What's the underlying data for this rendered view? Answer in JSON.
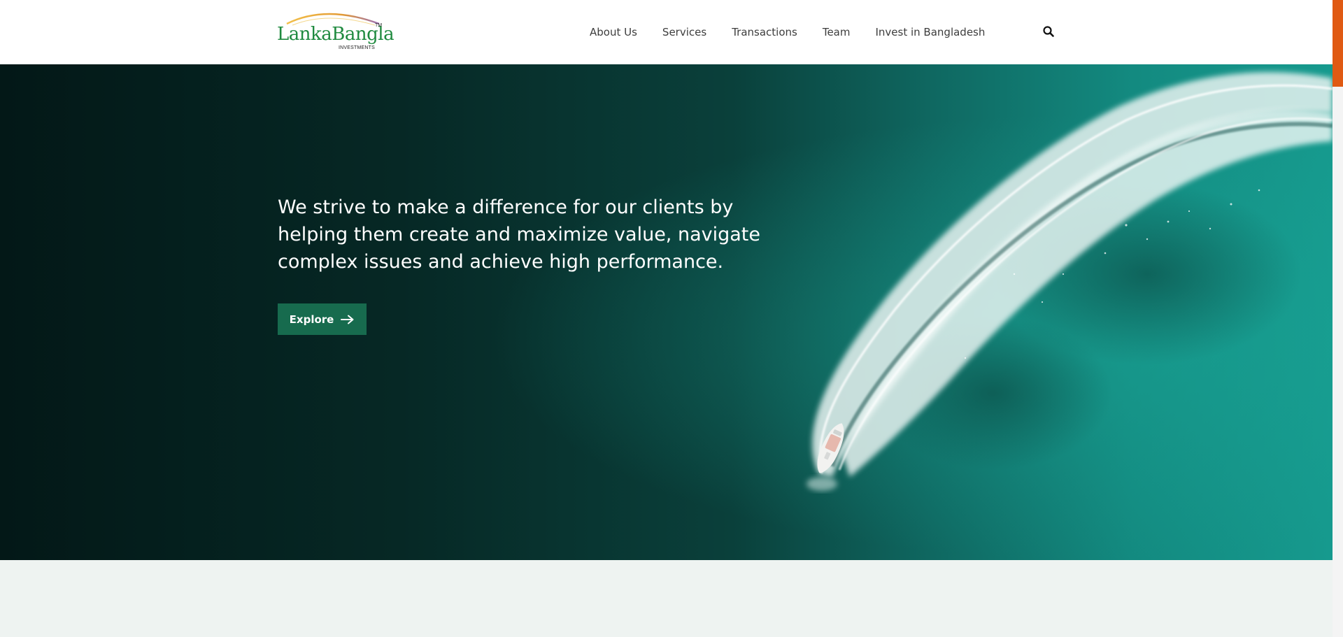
{
  "header": {
    "logo": {
      "word": "LankaBangla",
      "tm": "TM",
      "sub": "INVESTMENTS"
    },
    "nav": [
      {
        "label": "About Us"
      },
      {
        "label": "Services"
      },
      {
        "label": "Transactions"
      },
      {
        "label": "Team"
      },
      {
        "label": "Invest in Bangladesh"
      }
    ],
    "search_icon": "search-icon"
  },
  "hero": {
    "headline": "We strive to make a difference for our clients by helping them create and maximize value, navigate complex issues and achieve high performance.",
    "cta_label": "Explore",
    "cta_icon": "arrow-right-icon",
    "image": "aerial-speedboat-wake-on-teal-water"
  },
  "colors": {
    "brand_green": "#1f8a3f",
    "button_green": "#176b4e",
    "logo_arc_orange": "#e8a23a",
    "scroll_accent": "#e05a13",
    "hero_dark": "#031817",
    "hero_teal": "#169a8e",
    "section_bg": "#eef3f1"
  }
}
